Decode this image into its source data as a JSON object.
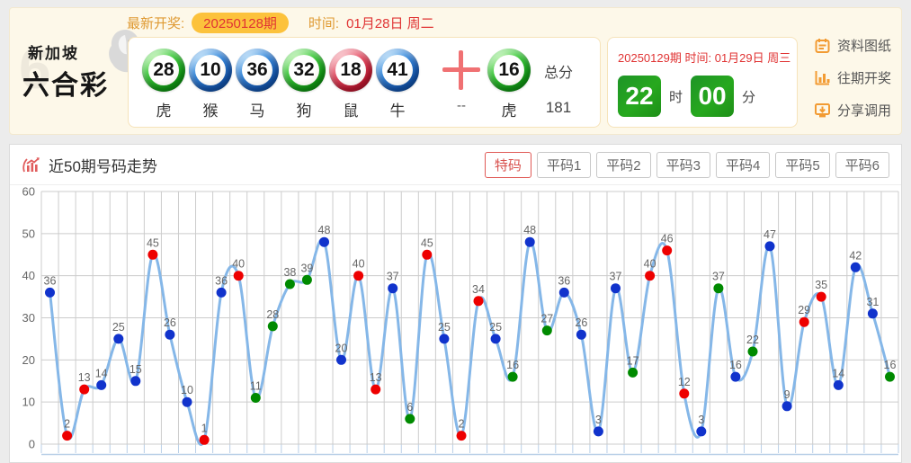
{
  "banner": {
    "logo": {
      "line1": "新加坡",
      "line2": "六合彩",
      "watermark": "6"
    },
    "latest": {
      "label": "最新开奖:",
      "issue": "20250128期",
      "time_label": "时间:",
      "date": "01月28日 周二"
    },
    "balls": [
      {
        "num": "28",
        "color": "green",
        "zodiac": "虎"
      },
      {
        "num": "10",
        "color": "blue",
        "zodiac": "猴"
      },
      {
        "num": "36",
        "color": "blue",
        "zodiac": "马"
      },
      {
        "num": "32",
        "color": "green",
        "zodiac": "狗"
      },
      {
        "num": "18",
        "color": "red",
        "zodiac": "鼠"
      },
      {
        "num": "41",
        "color": "blue",
        "zodiac": "牛"
      }
    ],
    "plus_label": "--",
    "special_ball": {
      "num": "16",
      "color": "green",
      "zodiac": "虎"
    },
    "total": {
      "label": "总分",
      "value": "181"
    },
    "next_draw": {
      "issue": "20250129期",
      "time_label": "时间:",
      "date": "01月29日 周三",
      "hour": "22",
      "hour_unit": "时",
      "minute": "00",
      "minute_unit": "分"
    },
    "links": [
      {
        "label": "资料图纸",
        "icon": "notebook-icon"
      },
      {
        "label": "往期开奖",
        "icon": "bar-chart-icon"
      },
      {
        "label": "分享调用",
        "icon": "share-icon"
      }
    ]
  },
  "chart_panel": {
    "title": "近50期号码走势",
    "tabs": [
      {
        "label": "特码",
        "active": true
      },
      {
        "label": "平码1",
        "active": false
      },
      {
        "label": "平码2",
        "active": false
      },
      {
        "label": "平码3",
        "active": false
      },
      {
        "label": "平码4",
        "active": false
      },
      {
        "label": "平码5",
        "active": false
      },
      {
        "label": "平码6",
        "active": false
      }
    ]
  },
  "chart_data": {
    "type": "line",
    "title": "近50期号码走势",
    "xlabel": "",
    "ylabel": "",
    "ylim": [
      0,
      60
    ],
    "yticks": [
      0,
      10,
      20,
      30,
      40,
      50,
      60
    ],
    "grid": true,
    "legend": "none",
    "line_color": "#85b7e8",
    "grid_color": "#cccccc",
    "axis_label_color": "#666666",
    "point_label_color": "#666666",
    "bottom_axis_color": "#b9cfe7",
    "point_colors": {
      "red": "#ee0000",
      "blue": "#1133cc",
      "green": "#008a00"
    },
    "values": [
      36,
      2,
      13,
      14,
      25,
      15,
      45,
      26,
      10,
      1,
      36,
      40,
      11,
      28,
      38,
      39,
      48,
      20,
      40,
      13,
      37,
      6,
      45,
      25,
      2,
      34,
      25,
      16,
      48,
      27,
      36,
      26,
      3,
      37,
      17,
      40,
      46,
      12,
      3,
      37,
      16,
      22,
      47,
      9,
      29,
      35,
      14,
      42,
      31,
      16
    ],
    "colors": [
      "blue",
      "red",
      "red",
      "blue",
      "blue",
      "blue",
      "red",
      "blue",
      "blue",
      "red",
      "blue",
      "red",
      "green",
      "green",
      "green",
      "green",
      "blue",
      "blue",
      "red",
      "red",
      "blue",
      "green",
      "red",
      "blue",
      "red",
      "red",
      "blue",
      "green",
      "blue",
      "green",
      "blue",
      "blue",
      "blue",
      "blue",
      "green",
      "red",
      "red",
      "red",
      "blue",
      "green",
      "blue",
      "green",
      "blue",
      "blue",
      "red",
      "red",
      "blue",
      "blue",
      "blue",
      "green"
    ]
  }
}
